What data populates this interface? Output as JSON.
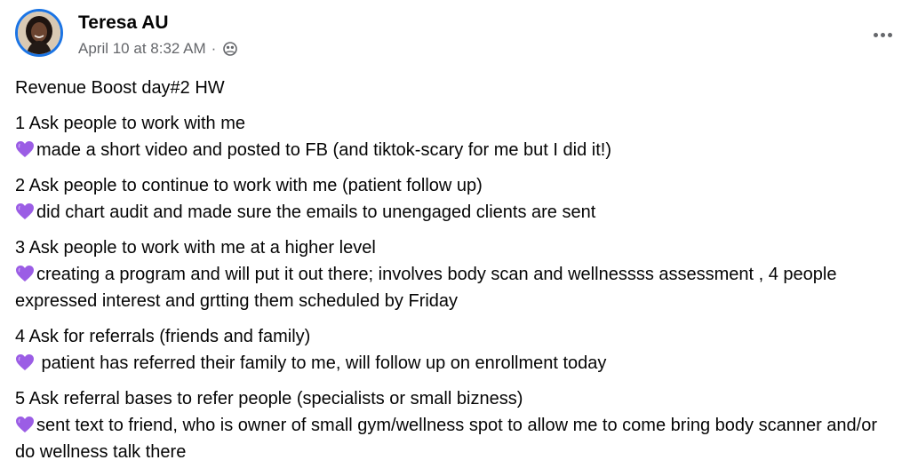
{
  "post": {
    "author": "Teresa AU",
    "timestamp": "April 10 at 8:32 AM",
    "separator": "·",
    "audience_icon": "friends-icon",
    "more_icon": "more-options-icon",
    "title": "Revenue Boost day#2 HW",
    "items": [
      {
        "heading": "1 Ask people to work with me",
        "response": "made a short video and posted to FB (and tiktok-scary for me but I did it!)"
      },
      {
        "heading": "2 Ask people to continue to work with me (patient follow up)",
        "response": "did chart audit and made sure the emails to unengaged clients are sent"
      },
      {
        "heading": "3 Ask people to work with me at a higher level",
        "response": "creating a program and will put it out there; involves body scan and wellnessss assessment , 4 people expressed interest and grtting them scheduled by Friday"
      },
      {
        "heading": "4 Ask for referrals (friends and family)",
        "response": " patient has referred their family to me, will follow up on enrollment today"
      },
      {
        "heading": "5 Ask referral bases to refer people (specialists or small bizness)",
        "response": "sent text to friend, who is owner of small gym/wellness spot to allow me to come bring body scanner and/or do wellness talk there"
      }
    ],
    "bullet_icon": "purple-heart-icon"
  },
  "colors": {
    "avatar_ring": "#1b74e4",
    "meta_text": "#65676b",
    "heart": "#9b5de5"
  }
}
